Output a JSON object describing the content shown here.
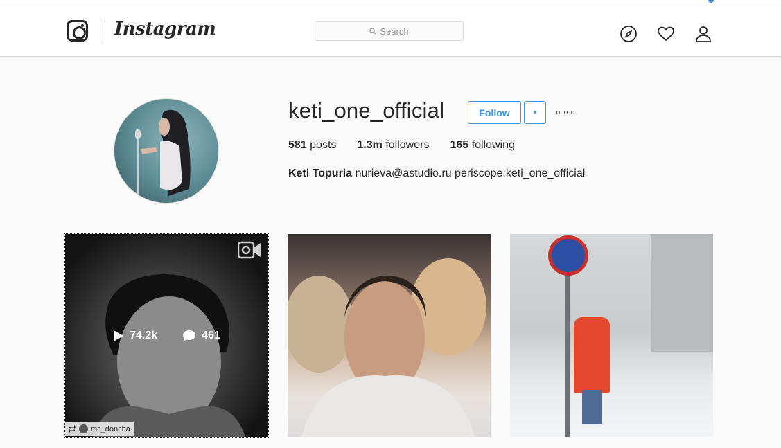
{
  "header": {
    "wordmark": "Instagram",
    "search_placeholder": "Search",
    "icons": [
      "instagram-logo-icon",
      "compass-icon",
      "heart-icon",
      "person-icon"
    ]
  },
  "profile": {
    "username": "keti_one_official",
    "follow_label": "Follow",
    "dropdown_label": "▾",
    "stats": {
      "posts_count": "581",
      "posts_label": "posts",
      "followers_count": "1.3m",
      "followers_label": "followers",
      "following_count": "165",
      "following_label": "following"
    },
    "bio_name": "Keti Topuria",
    "bio_text": "nurieva@astudio.ru periscope:keti_one_official"
  },
  "posts": [
    {
      "type": "video",
      "views": "74.2k",
      "comments": "461",
      "repost_user": "mc_doncha"
    },
    {
      "type": "photo"
    },
    {
      "type": "photo"
    }
  ],
  "colors": {
    "accent": "#3897f0",
    "text": "#262626",
    "background": "#fafafa",
    "border": "#dbdbdb"
  }
}
